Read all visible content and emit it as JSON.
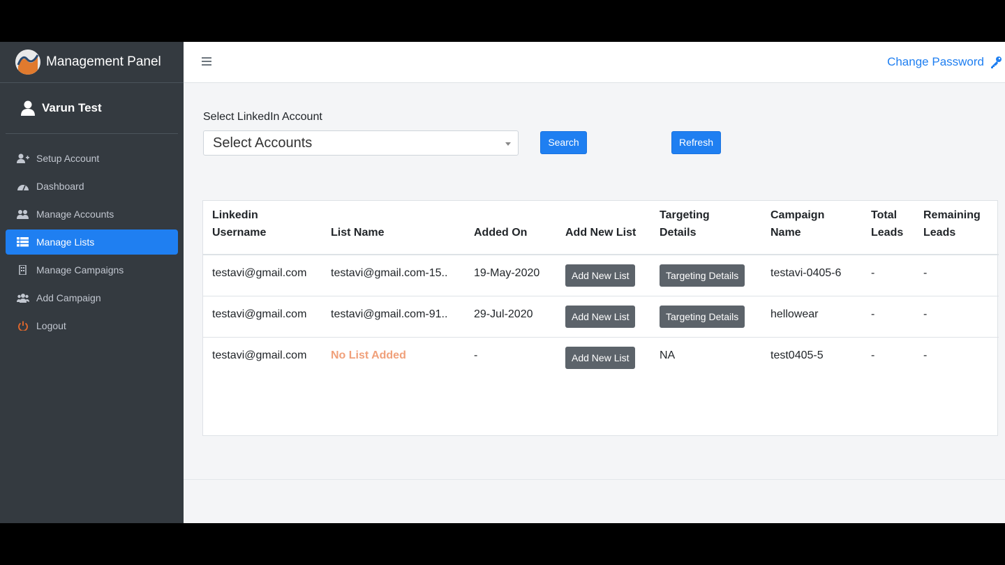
{
  "app": {
    "brand": "Management Panel",
    "user": "Varun Test"
  },
  "header": {
    "change_password": "Change Password"
  },
  "sidebar": {
    "items": [
      {
        "label": "Setup Account",
        "icon": "user-plus-icon",
        "active": false
      },
      {
        "label": "Dashboard",
        "icon": "tachometer-icon",
        "active": false
      },
      {
        "label": "Manage Accounts",
        "icon": "users-icon",
        "active": false
      },
      {
        "label": "Manage Lists",
        "icon": "list-icon",
        "active": true
      },
      {
        "label": "Manage Campaigns",
        "icon": "building-icon",
        "active": false
      },
      {
        "label": "Add Campaign",
        "icon": "users-group-icon",
        "active": false
      },
      {
        "label": "Logout",
        "icon": "power-icon",
        "active": false
      }
    ]
  },
  "filter": {
    "label": "Select LinkedIn Account",
    "select_value": "Select Accounts",
    "search_label": "Search",
    "refresh_label": "Refresh"
  },
  "table": {
    "headers": {
      "username_1": "Linkedin",
      "username_2": "Username",
      "list_name": "List Name",
      "added_on": "Added On",
      "add_new_list": "Add New List",
      "targeting_1": "Targeting",
      "targeting_2": "Details",
      "campaign_1": "Campaign",
      "campaign_2": "Name",
      "total_1": "Total",
      "total_2": "Leads",
      "remaining_1": "Remaining",
      "remaining_2": "Leads"
    },
    "rows": [
      {
        "username": "testavi@gmail.com",
        "list_name": "testavi@gmail.com-15..",
        "added_on": "19-May-2020",
        "add_label": "Add New List",
        "targeting": "Targeting Details",
        "campaign": "testavi-0405-6",
        "total": "-",
        "remaining": "-"
      },
      {
        "username": "testavi@gmail.com",
        "list_name": "testavi@gmail.com-91..",
        "added_on": "29-Jul-2020",
        "add_label": "Add New List",
        "targeting": "Targeting Details",
        "campaign": "hellowear",
        "total": "-",
        "remaining": "-"
      },
      {
        "username": "testavi@gmail.com",
        "list_name": "No List Added",
        "added_on": "-",
        "add_label": "Add New List",
        "targeting": "NA",
        "campaign": "test0405-5",
        "total": "-",
        "remaining": "-"
      }
    ]
  },
  "colors": {
    "accent": "#1f7ff1",
    "sidebar_bg": "#343a40",
    "warning_text": "#f0a07a",
    "secondary_btn": "#5c636a"
  }
}
